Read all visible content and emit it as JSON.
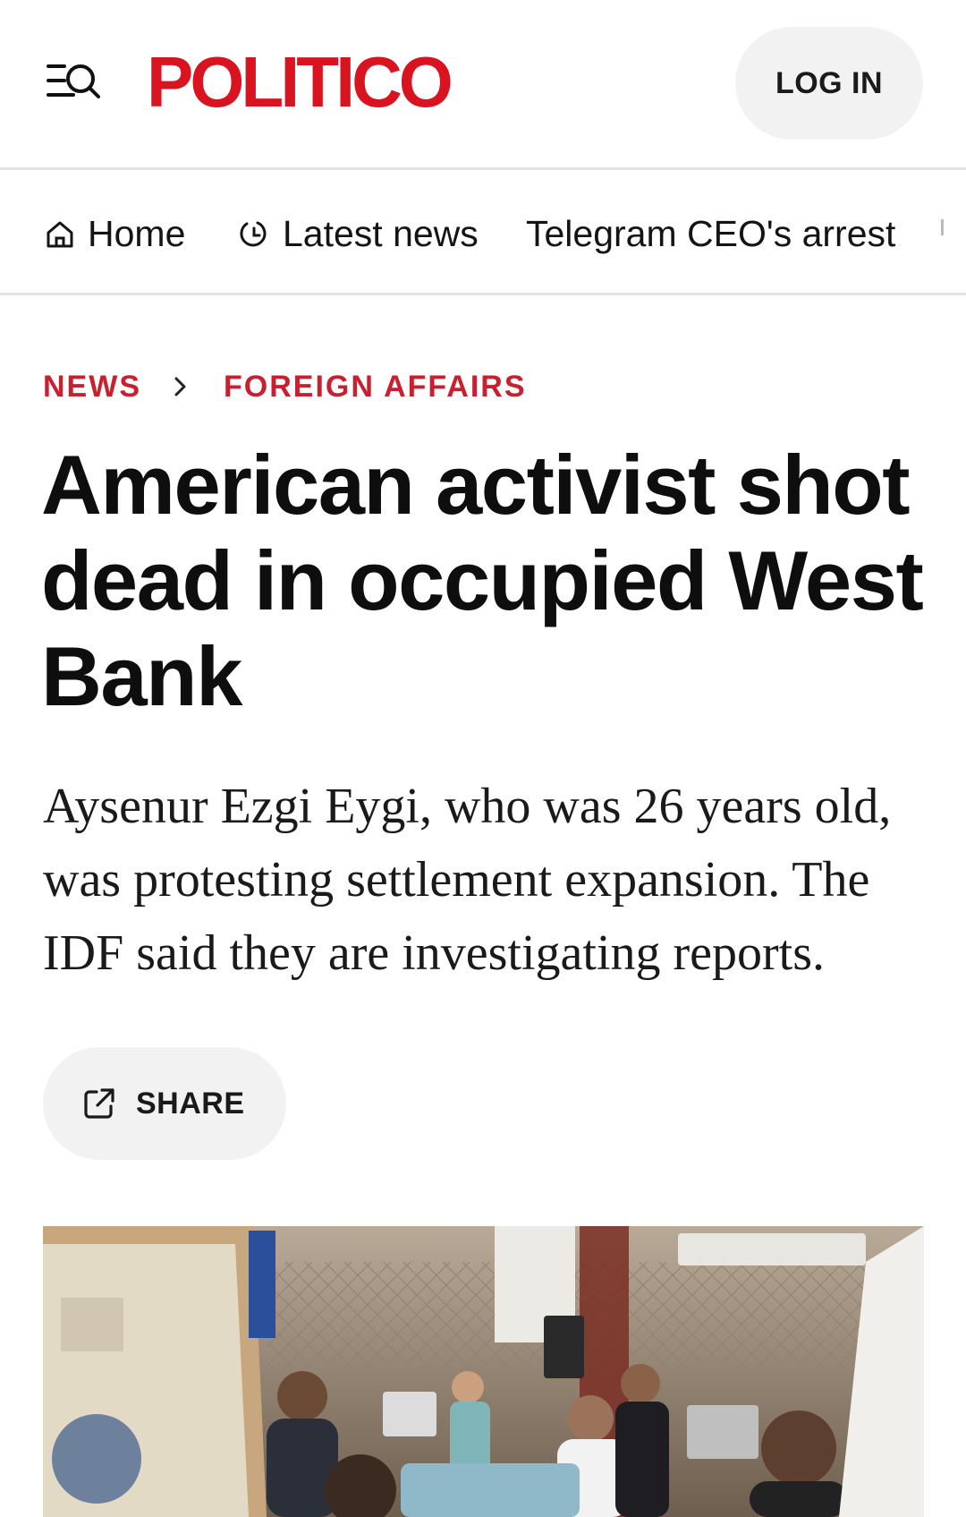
{
  "header": {
    "menu_icon": "menu-search-icon",
    "logo": "POLITICO",
    "login_label": "LOG IN",
    "brand_color": "#d9131f"
  },
  "nav": {
    "items": [
      {
        "label": "Home",
        "icon": "home-icon"
      },
      {
        "label": "Latest news",
        "icon": "refresh-icon"
      },
      {
        "label": "Telegram CEO's arrest"
      }
    ]
  },
  "breadcrumb": {
    "items": [
      "NEWS",
      "FOREIGN AFFAIRS"
    ],
    "separator_icon": "chevron-right-icon",
    "color": "#c8202e"
  },
  "article": {
    "headline": "American activist shot dead in occupied West Bank",
    "dek": "Aysenur Ezgi Eygi, who was 26 years old, was protesting settlement expansion. The IDF said they are investigating reports.",
    "share_label": "SHARE",
    "share_icon": "external-share-icon"
  }
}
